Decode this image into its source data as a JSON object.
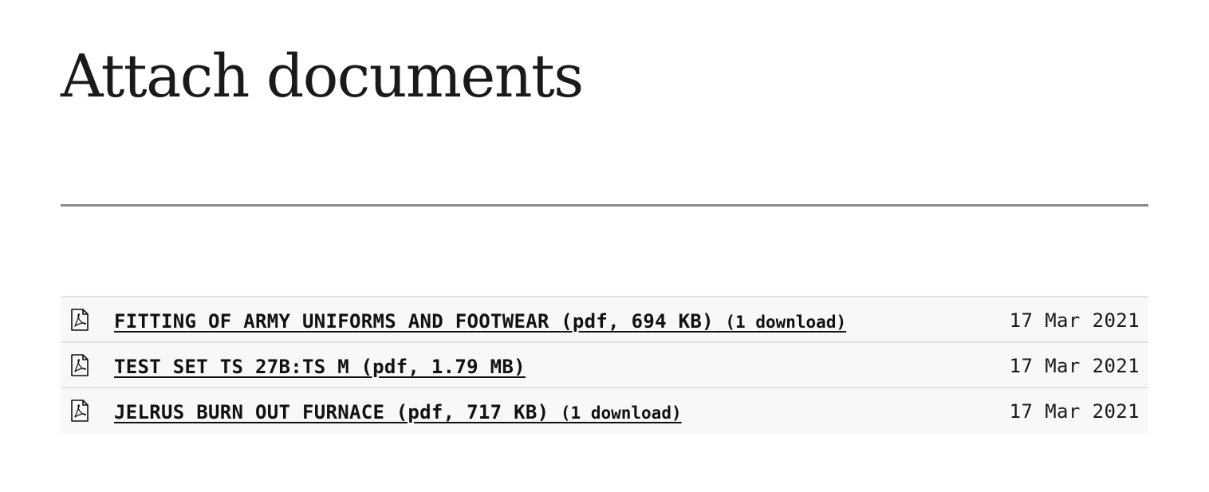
{
  "page": {
    "title": "Attach documents"
  },
  "documents": [
    {
      "name": "FITTING OF ARMY UNIFORMS AND FOOTWEAR",
      "meta": "(pdf, 694 KB)",
      "downloads": "(1 download)",
      "date": "17 Mar 2021",
      "icon": "pdf-file-icon"
    },
    {
      "name": "TEST SET TS 27B:TS M",
      "meta": "(pdf, 1.79 MB)",
      "downloads": "",
      "date": "17 Mar 2021",
      "icon": "pdf-file-icon"
    },
    {
      "name": "JELRUS BURN OUT FURNACE",
      "meta": "(pdf, 717 KB)",
      "downloads": "(1 download)",
      "date": "17 Mar 2021",
      "icon": "pdf-file-icon"
    }
  ],
  "colors": {
    "text": "#111111",
    "divider": "#8a8a8a",
    "row_background": "#f8f8f8",
    "row_border": "#e2e2e2"
  }
}
